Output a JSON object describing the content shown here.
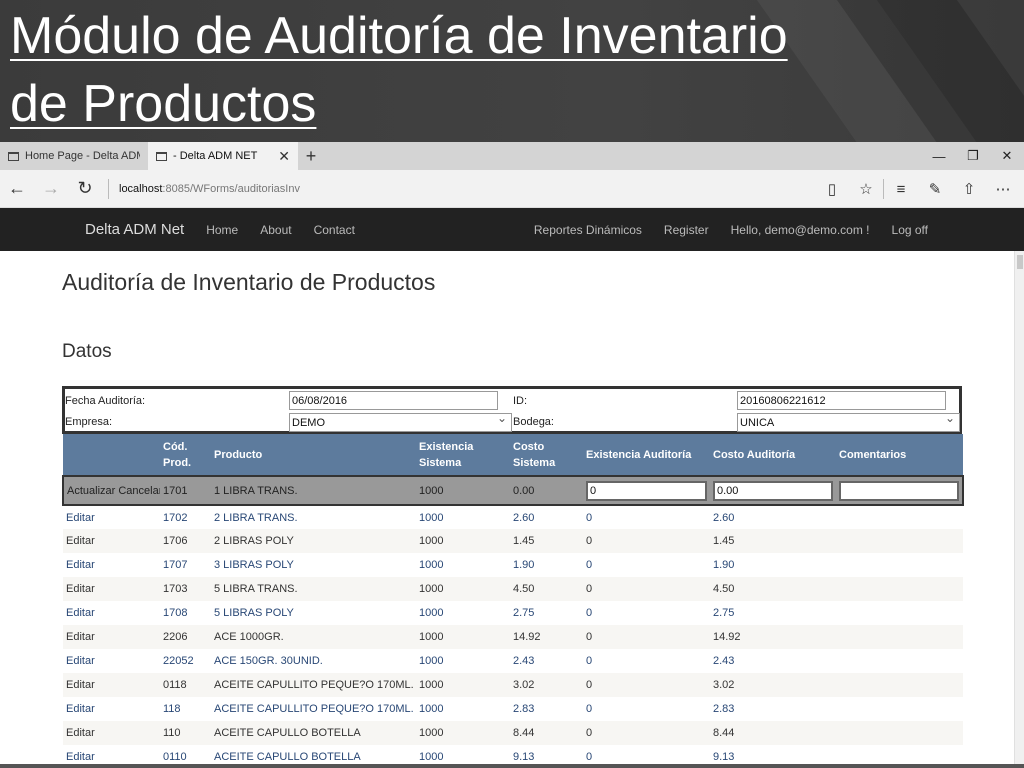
{
  "slide": {
    "title_line1": "Módulo de Auditoría de Inventario",
    "title_line2": "de Productos"
  },
  "browser": {
    "tabs": [
      {
        "label": "Home Page - Delta ADM NE",
        "active": false
      },
      {
        "label": "- Delta ADM NET",
        "active": true
      }
    ],
    "url_host": "localhost",
    "url_rest": ":8085/WForms/auditoriasInv"
  },
  "site_nav": {
    "brand": "Delta ADM Net",
    "links_left": [
      "Home",
      "About",
      "Contact"
    ],
    "links_right": [
      "Reportes Dinámicos",
      "Register",
      "Hello, demo@demo.com !",
      "Log off"
    ]
  },
  "page": {
    "title": "Auditoría de Inventario de Productos",
    "section": "Datos",
    "form": {
      "fecha_label": "Fecha Auditoría:",
      "fecha_value": "06/08/2016",
      "id_label": "ID:",
      "id_value": "20160806221612",
      "empresa_label": "Empresa:",
      "empresa_value": "DEMO",
      "bodega_label": "Bodega:",
      "bodega_value": "UNICA"
    },
    "grid": {
      "headers": [
        "",
        "Cód. Prod.",
        "Producto",
        "Existencia Sistema",
        "Costo Sistema",
        "Existencia Auditoría",
        "Costo Auditoría",
        "Comentarios"
      ],
      "edit_row": {
        "actions": "Actualizar Cancelar",
        "code": "1701",
        "product": "1 LIBRA TRANS.",
        "existencia": "1000",
        "costo": "0.00",
        "exist_aud": "0",
        "costo_aud": "0.00",
        "comentarios": ""
      },
      "rows": [
        {
          "action": "Editar",
          "code": "1702",
          "product": "2 LIBRA TRANS.",
          "existencia": "1000",
          "costo": "2.60",
          "exist_aud": "0",
          "costo_aud": "2.60"
        },
        {
          "action": "Editar",
          "code": "1706",
          "product": "2 LIBRAS POLY",
          "existencia": "1000",
          "costo": "1.45",
          "exist_aud": "0",
          "costo_aud": "1.45"
        },
        {
          "action": "Editar",
          "code": "1707",
          "product": "3 LIBRAS POLY",
          "existencia": "1000",
          "costo": "1.90",
          "exist_aud": "0",
          "costo_aud": "1.90"
        },
        {
          "action": "Editar",
          "code": "1703",
          "product": "5 LIBRA TRANS.",
          "existencia": "1000",
          "costo": "4.50",
          "exist_aud": "0",
          "costo_aud": "4.50"
        },
        {
          "action": "Editar",
          "code": "1708",
          "product": "5 LIBRAS POLY",
          "existencia": "1000",
          "costo": "2.75",
          "exist_aud": "0",
          "costo_aud": "2.75"
        },
        {
          "action": "Editar",
          "code": "2206",
          "product": "ACE 1000GR.",
          "existencia": "1000",
          "costo": "14.92",
          "exist_aud": "0",
          "costo_aud": "14.92"
        },
        {
          "action": "Editar",
          "code": "22052",
          "product": "ACE 150GR. 30UNID.",
          "existencia": "1000",
          "costo": "2.43",
          "exist_aud": "0",
          "costo_aud": "2.43"
        },
        {
          "action": "Editar",
          "code": "0118",
          "product": "ACEITE CAPULLITO PEQUE?O 170ML.",
          "existencia": "1000",
          "costo": "3.02",
          "exist_aud": "0",
          "costo_aud": "3.02"
        },
        {
          "action": "Editar",
          "code": "118",
          "product": "ACEITE CAPULLITO PEQUE?O 170ML.",
          "existencia": "1000",
          "costo": "2.83",
          "exist_aud": "0",
          "costo_aud": "2.83"
        },
        {
          "action": "Editar",
          "code": "110",
          "product": "ACEITE CAPULLO BOTELLA",
          "existencia": "1000",
          "costo": "8.44",
          "exist_aud": "0",
          "costo_aud": "8.44"
        },
        {
          "action": "Editar",
          "code": "0110",
          "product": "ACEITE CAPULLO BOTELLA",
          "existencia": "1000",
          "costo": "9.13",
          "exist_aud": "0",
          "costo_aud": "9.13"
        }
      ]
    }
  }
}
